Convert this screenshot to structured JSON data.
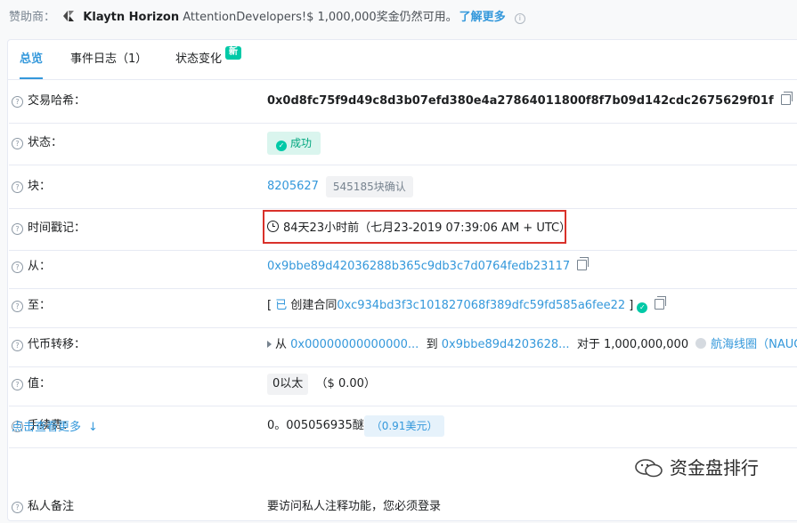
{
  "sponsor": {
    "prefix": "赞助商：",
    "brand": "Klaytn Horizon",
    "text": " AttentionDevelopers!$ 1,000,000奖金仍然可用。",
    "more": "了解更多",
    "info_glyph": "i"
  },
  "tabs": [
    {
      "label": "总览"
    },
    {
      "label": "事件日志（1）"
    },
    {
      "label": "状态变化",
      "badge": "新"
    }
  ],
  "rows": {
    "hash": {
      "label": "交易哈希：",
      "value": "0x0d8fc75f9d49c8d3b07efd380e4a27864011800f8f7b09d142cdc2675629f01f"
    },
    "status": {
      "label": "状态：",
      "value": "成功"
    },
    "block": {
      "label": "块：",
      "number": "8205627",
      "confirmations": "545185块确认"
    },
    "timestamp": {
      "label": "时间戳记：",
      "value": "84天23小时前（七月23-2019 07:39:06 AM + UTC）"
    },
    "from": {
      "label": "从：",
      "value": "0x9bbe89d42036288b365c9db3c7d0764fedb23117"
    },
    "to": {
      "label": "至：",
      "open": "[",
      "created": " 已 ",
      "created_text": "创建合同",
      "contract": "0xc934bd3f3c101827068f389dfc59fd585a6fee22",
      "close": " ]"
    },
    "token": {
      "label": "代币转移：",
      "from_label": "从",
      "from_addr": "0x00000000000000...",
      "to_label": "到",
      "to_addr": "0x9bbe89d4203628...",
      "for_label": "对于",
      "amount": "1,000,000,000",
      "token_name": "航海线圈（NAUC）"
    },
    "value": {
      "label": "值：",
      "amount": "0以太",
      "usd": "（$ 0.00）"
    },
    "fee": {
      "label": "手续费：",
      "amount": "0。005056935醚",
      "usd": "（0.91美元）"
    }
  },
  "show_more": {
    "label": "点击查看更多",
    "arrow": "↓"
  },
  "last_row": {
    "label": "私人备注",
    "value": "要访问私人注释功能，您必须登录"
  },
  "watermark": "资金盘排行",
  "colors": {
    "accent": "#3498db",
    "success": "#00c9a7",
    "highlight": "#d9312a"
  }
}
